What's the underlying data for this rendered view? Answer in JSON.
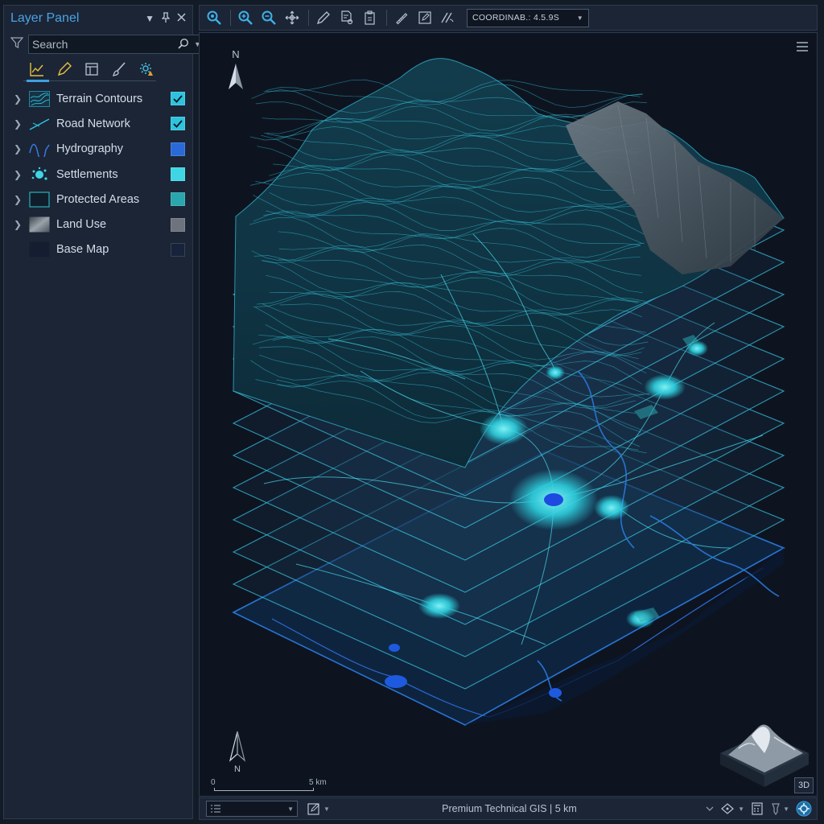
{
  "panel": {
    "title": "Layer Panel",
    "search_placeholder": "Search",
    "tools": [
      "chart-line-icon",
      "pencil-icon",
      "table-icon",
      "brush-icon",
      "gear-alert-icon"
    ],
    "layers": [
      {
        "name": "Terrain Contours",
        "expandable": true,
        "swatch": "contour-icon",
        "visible": true,
        "color": "#2ec3dd"
      },
      {
        "name": "Road Network",
        "expandable": true,
        "swatch": "road-line-icon",
        "visible": true,
        "color": "#2ec3dd"
      },
      {
        "name": "Hydrography",
        "expandable": true,
        "swatch": "wave-icon",
        "visible": false,
        "color": "#2a6ad8"
      },
      {
        "name": "Settlements",
        "expandable": true,
        "swatch": "settlement-icon",
        "visible": false,
        "color": "#3fd5e5"
      },
      {
        "name": "Protected Areas",
        "expandable": true,
        "swatch": "square-outline-icon",
        "visible": false,
        "color": "#2aa6ae"
      },
      {
        "name": "Land Use",
        "expandable": true,
        "swatch": "gradient-square-icon",
        "visible": false,
        "color": "#6d747d"
      },
      {
        "name": "Base Map",
        "expandable": false,
        "swatch": "dark-square-icon",
        "visible": false,
        "color": "#16233a"
      }
    ]
  },
  "toolbar": {
    "coordinate_value": "COORDINAB.: 4.5.9S"
  },
  "map": {
    "north_label": "N",
    "scale_start": "0",
    "scale_end": "5 km",
    "view_mode": "3D"
  },
  "status": {
    "text": "Premium Technical GIS | 5 km"
  },
  "colors": {
    "accent": "#3fa0e0",
    "cyan": "#2ec3dd",
    "panel": "#1b2535",
    "viewport": "#0d1420"
  }
}
